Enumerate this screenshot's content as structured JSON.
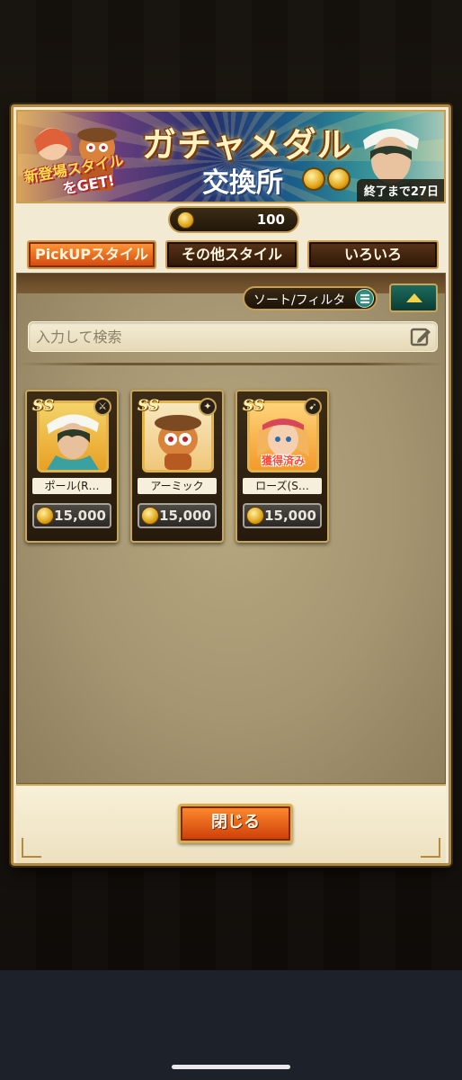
{
  "banner": {
    "title": "ガチャメダル",
    "subtitle": "交換所",
    "tagline_line1": "新登場スタイル",
    "tagline_line2": "をGET!",
    "deadline": "終了まで27日"
  },
  "currency": {
    "icon": "medal-coin-icon",
    "amount": "100"
  },
  "tabs": [
    {
      "label": "PickUPスタイル",
      "active": true
    },
    {
      "label": "その他スタイル",
      "active": false
    },
    {
      "label": "いろいろ",
      "active": false
    }
  ],
  "toolbar": {
    "sort_filter_label": "ソート/フィルタ"
  },
  "search": {
    "placeholder": "入力して検索"
  },
  "items": [
    {
      "rank": "SS",
      "name": "ポール(R…",
      "cost": "15,000",
      "owned": "",
      "weapon_icon": "sword-icon"
    },
    {
      "rank": "SS",
      "name": "アーミック",
      "cost": "15,000",
      "owned": "",
      "weapon_icon": "axe-icon"
    },
    {
      "rank": "SS",
      "name": "ローズ(S…",
      "cost": "15,000",
      "owned": "獲得済み",
      "weapon_icon": "gun-icon"
    }
  ],
  "footer": {
    "close_label": "閉じる"
  },
  "colors": {
    "accent_orange": "#e3621a",
    "gold_border": "#c9a556",
    "panel": "#a59571"
  }
}
